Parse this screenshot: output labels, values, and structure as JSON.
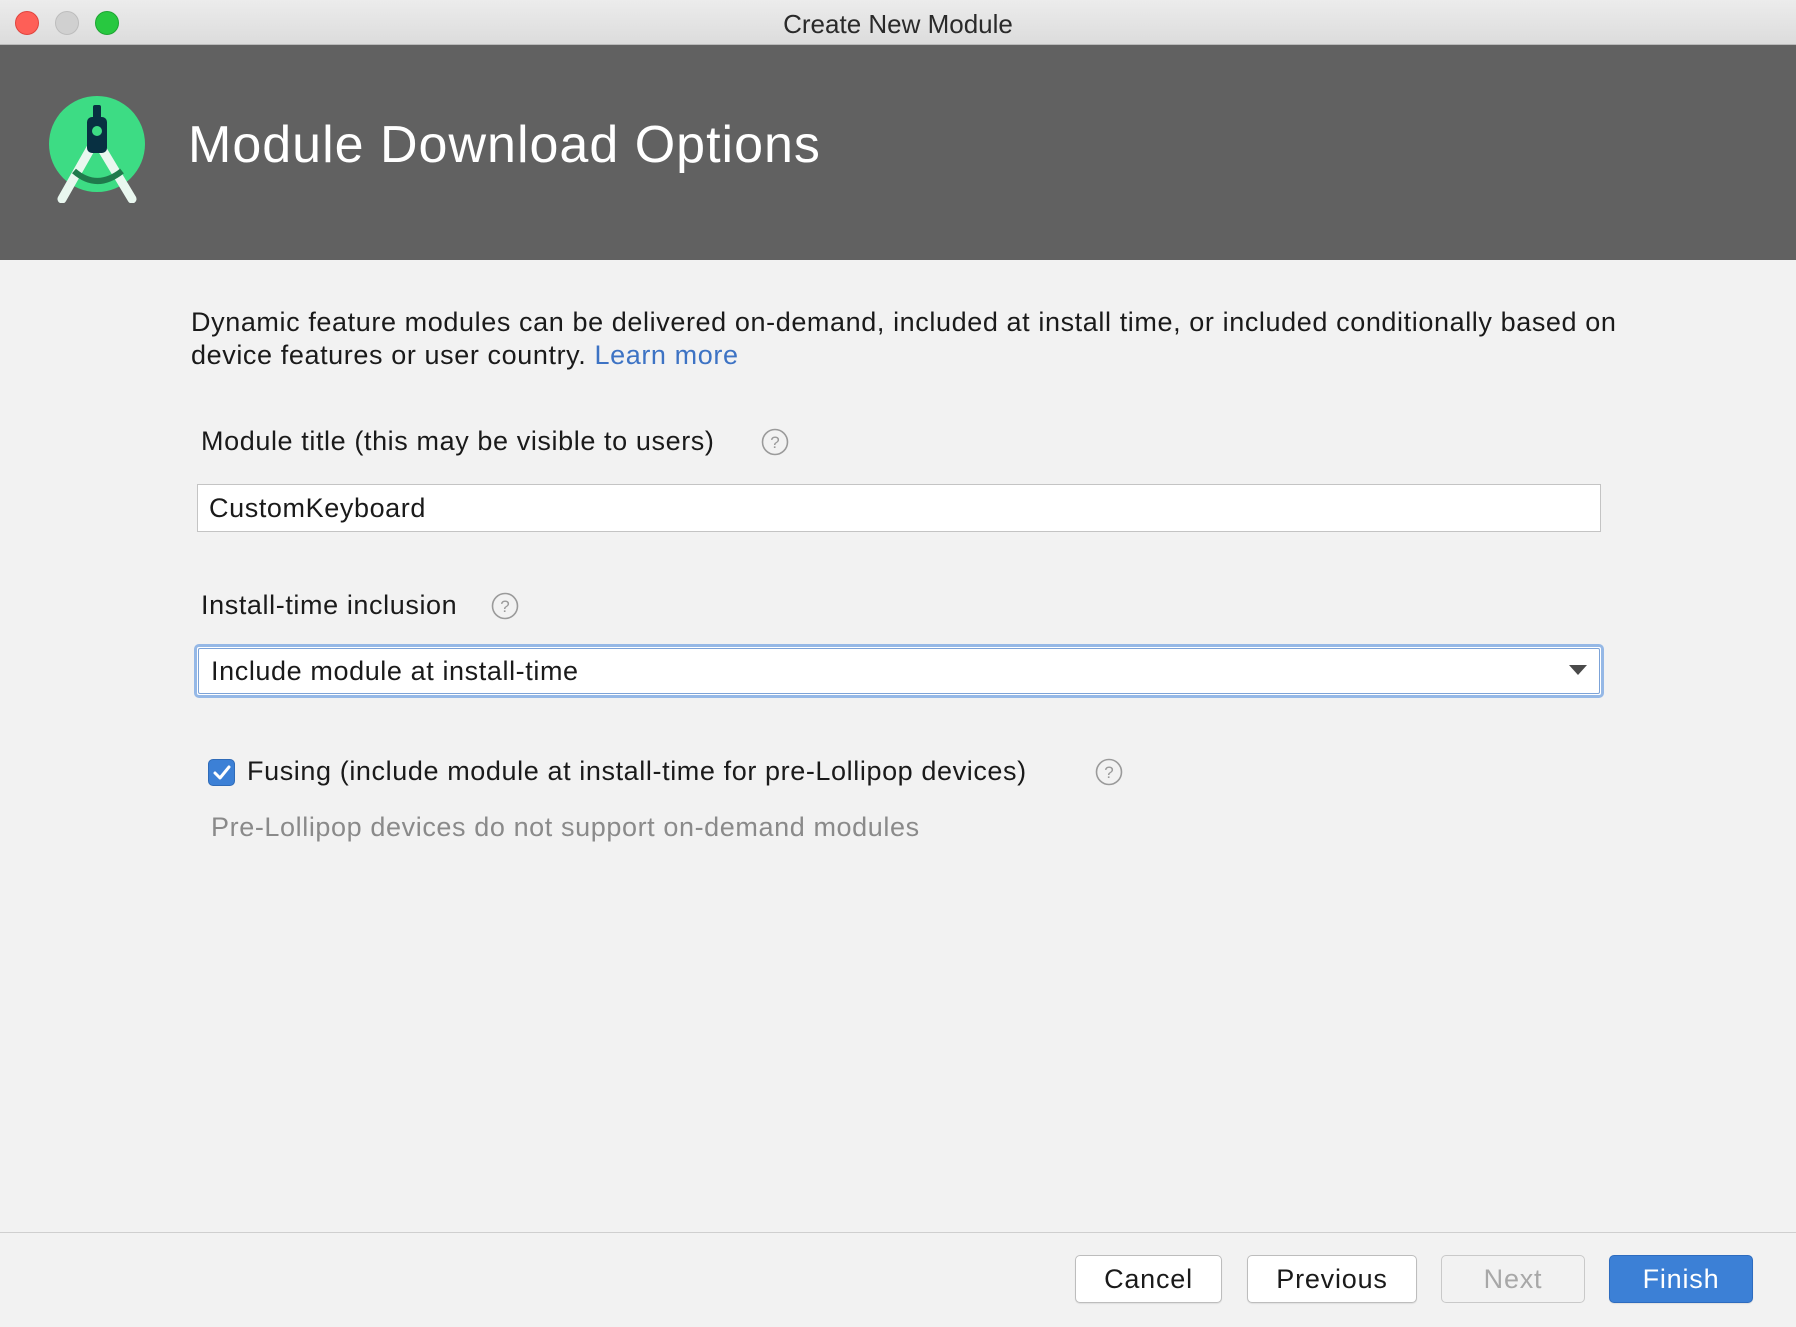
{
  "window": {
    "title": "Create New Module"
  },
  "header": {
    "title": "Module Download Options",
    "logo_icon": "android-studio-logo-icon"
  },
  "description": {
    "text": "Dynamic feature modules can be delivered on-demand, included at install time, or included conditionally based on device features or user country. ",
    "link_text": "Learn more"
  },
  "module_title": {
    "label": "Module title (this may be visible to users)",
    "value": "CustomKeyboard"
  },
  "install_time": {
    "label": "Install-time inclusion",
    "selected": "Include module at install-time"
  },
  "fusing": {
    "label": "Fusing (include module at install-time for pre-Lollipop devices)",
    "checked": true,
    "hint": "Pre-Lollipop devices do not support on-demand modules"
  },
  "buttons": {
    "cancel": "Cancel",
    "previous": "Previous",
    "next": "Next",
    "finish": "Finish"
  },
  "colors": {
    "header_bg": "#616161",
    "accent": "#3c80d6",
    "link": "#3d73c4",
    "logo_green": "#3ddc84"
  }
}
